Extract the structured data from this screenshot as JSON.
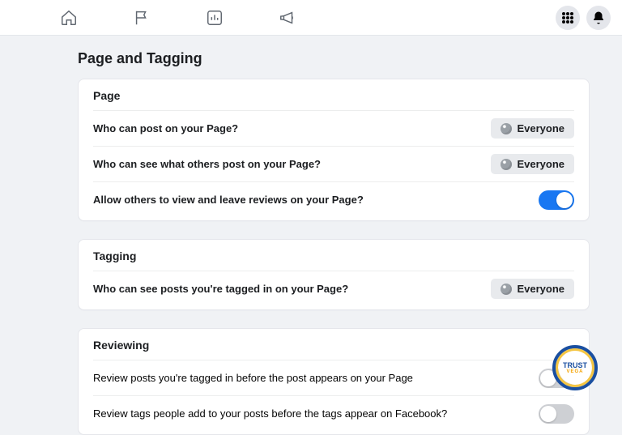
{
  "header": {
    "title": "Page and Tagging"
  },
  "audience": {
    "everyone": "Everyone"
  },
  "sections": {
    "page": {
      "title": "Page",
      "rows": {
        "who_post": {
          "label": "Who can post on your Page?"
        },
        "who_see": {
          "label": "Who can see what others post on your Page?"
        },
        "reviews": {
          "label": "Allow others to view and leave reviews on your Page?"
        }
      }
    },
    "tagging": {
      "title": "Tagging",
      "rows": {
        "who_tagged": {
          "label": "Who can see posts you're tagged in on your Page?"
        }
      }
    },
    "reviewing": {
      "title": "Reviewing",
      "rows": {
        "review_posts": {
          "label": "Review posts you're tagged in before the post appears on your Page"
        },
        "review_tags": {
          "label": "Review tags people add to your posts before the tags appear on Facebook?"
        }
      }
    }
  },
  "watermark": {
    "line1": "TRUST",
    "line2": "VEGA"
  }
}
